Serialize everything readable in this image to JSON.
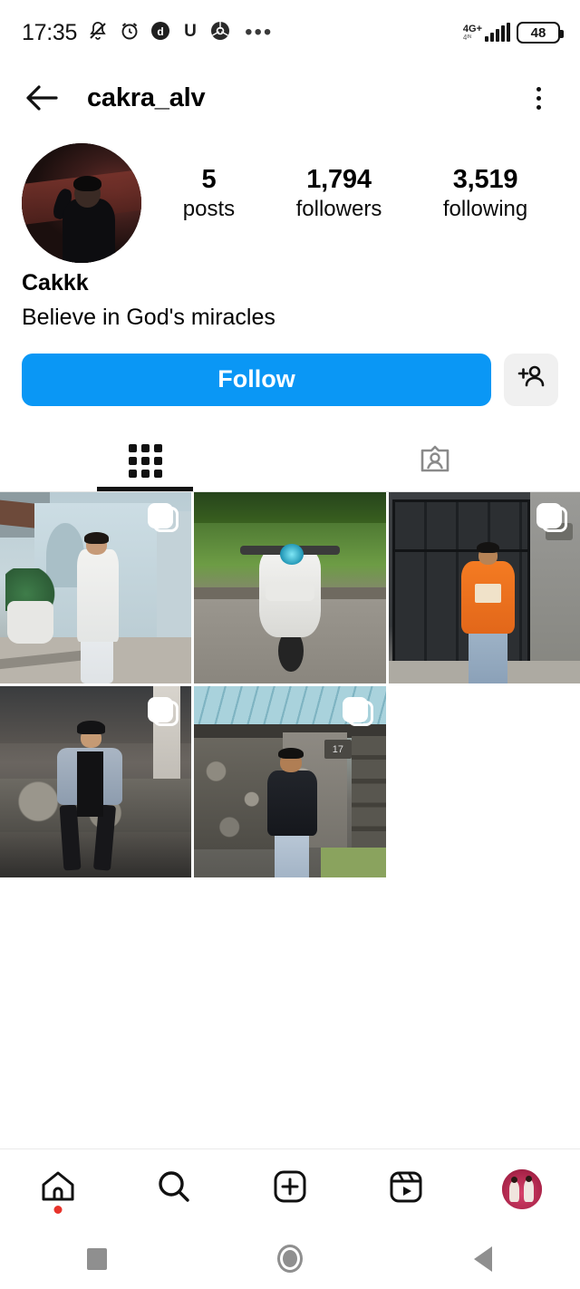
{
  "status_bar": {
    "time": "17:35",
    "icons": [
      "mute-bell-icon",
      "alarm-clock-icon",
      "app-d-icon",
      "app-u-icon",
      "chrome-icon"
    ],
    "overflow": "•••",
    "network": "4G+",
    "network_sub": "4ᴵᴺ",
    "battery": "48"
  },
  "header": {
    "back": "back-arrow",
    "title": "cakra_alv",
    "menu": "more-options"
  },
  "profile": {
    "avatar_alt": "profile-photo",
    "stats": [
      {
        "value": "5",
        "label": "posts"
      },
      {
        "value": "1,794",
        "label": "followers"
      },
      {
        "value": "3,519",
        "label": "following"
      }
    ],
    "display_name": "Cakkk",
    "bio": "Believe in God's miracles"
  },
  "actions": {
    "follow_label": "Follow",
    "suggest_icon": "add-person-icon",
    "follow_color": "#0a97f5"
  },
  "tabs": [
    {
      "id": "grid",
      "icon": "grid-icon",
      "active": true
    },
    {
      "id": "tagged",
      "icon": "tagged-person-icon",
      "active": false
    }
  ],
  "posts": [
    {
      "id": 1,
      "alt": "person in white shirt by light blue wall with potted plants",
      "multi": true
    },
    {
      "id": 2,
      "alt": "white vespa scooter parked on grass roadside",
      "multi": false
    },
    {
      "id": 3,
      "alt": "person in orange hoodie in front of dark metal cabinets",
      "multi": true
    },
    {
      "id": 4,
      "alt": "person in denim jacket sitting on stone steps",
      "multi": true
    },
    {
      "id": 5,
      "alt": "person in black hoodie outside house number 17",
      "multi": true
    }
  ],
  "post_detail": {
    "house_number": "17"
  },
  "bottom_nav": [
    {
      "id": "home",
      "icon": "home-icon",
      "badge": true
    },
    {
      "id": "search",
      "icon": "search-icon",
      "badge": false
    },
    {
      "id": "create",
      "icon": "plus-box-icon",
      "badge": false
    },
    {
      "id": "reels",
      "icon": "reels-icon",
      "badge": false
    },
    {
      "id": "profile",
      "icon": "user-avatar",
      "badge": false
    }
  ],
  "system_nav": [
    {
      "id": "recents",
      "icon": "square-icon"
    },
    {
      "id": "home",
      "icon": "circle-icon"
    },
    {
      "id": "back",
      "icon": "triangle-back-icon"
    }
  ]
}
